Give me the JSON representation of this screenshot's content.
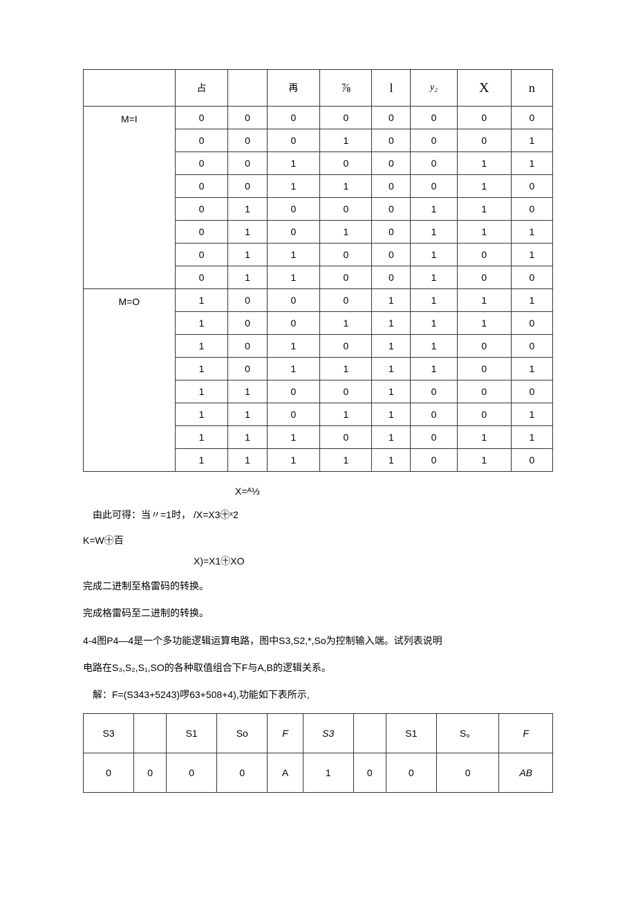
{
  "table1": {
    "header": [
      "",
      "占",
      "",
      "再",
      "⅞",
      "l",
      "y₂",
      "X",
      "n"
    ],
    "groups": [
      {
        "label": "M=I",
        "rows": [
          [
            "0",
            "0",
            "0",
            "0",
            "0",
            "0",
            "0",
            "0"
          ],
          [
            "0",
            "0",
            "0",
            "1",
            "0",
            "0",
            "0",
            "1"
          ],
          [
            "0",
            "0",
            "1",
            "0",
            "0",
            "0",
            "1",
            "1"
          ],
          [
            "0",
            "0",
            "1",
            "1",
            "0",
            "0",
            "1",
            "0"
          ],
          [
            "0",
            "1",
            "0",
            "0",
            "0",
            "1",
            "1",
            "0"
          ],
          [
            "0",
            "1",
            "0",
            "1",
            "0",
            "1",
            "1",
            "1"
          ],
          [
            "0",
            "1",
            "1",
            "0",
            "0",
            "1",
            "0",
            "1"
          ],
          [
            "0",
            "1",
            "1",
            "0",
            "0",
            "1",
            "0",
            "0"
          ]
        ]
      },
      {
        "label": "M=O",
        "rows": [
          [
            "1",
            "0",
            "0",
            "0",
            "1",
            "1",
            "1",
            "1"
          ],
          [
            "1",
            "0",
            "0",
            "1",
            "1",
            "1",
            "1",
            "0"
          ],
          [
            "1",
            "0",
            "1",
            "0",
            "1",
            "1",
            "0",
            "0"
          ],
          [
            "1",
            "0",
            "1",
            "1",
            "1",
            "1",
            "0",
            "1"
          ],
          [
            "1",
            "1",
            "0",
            "0",
            "1",
            "0",
            "0",
            "0"
          ],
          [
            "1",
            "1",
            "0",
            "1",
            "1",
            "0",
            "0",
            "1"
          ],
          [
            "1",
            "1",
            "1",
            "0",
            "1",
            "0",
            "1",
            "1"
          ],
          [
            "1",
            "1",
            "1",
            "1",
            "1",
            "0",
            "1",
            "0"
          ]
        ]
      }
    ]
  },
  "equations": {
    "eq1": "X=ᴬ⅓",
    "lead": "由此可得：当〃=1时，",
    "eq2": "/X=X3㊉ˣ2",
    "eq3": "K=W㊉百",
    "eq4": "X)=X1㊉XO"
  },
  "para1": "完成二进制至格雷码的转换。",
  "para2": "完成格雷码至二进制的转换。",
  "para3": "4-4图P4—4是一个多功能逻辑运算电路，图中S3,S2,*,So为控制输入端。试列表说明",
  "para4": "电路在S₃,S₂,S₁,SO的各种取值组合下F与A,B的逻辑关系。",
  "para5": "解：F=(S343+5243)啰63+508+4),功能如下表所示,",
  "table2": {
    "header": [
      "S3",
      "",
      "S1",
      "So",
      "F",
      "S3",
      "",
      "S1",
      "S。",
      "F"
    ],
    "row": [
      "0",
      "0",
      "0",
      "0",
      "A",
      "1",
      "0",
      "0",
      "0",
      "AB"
    ]
  }
}
